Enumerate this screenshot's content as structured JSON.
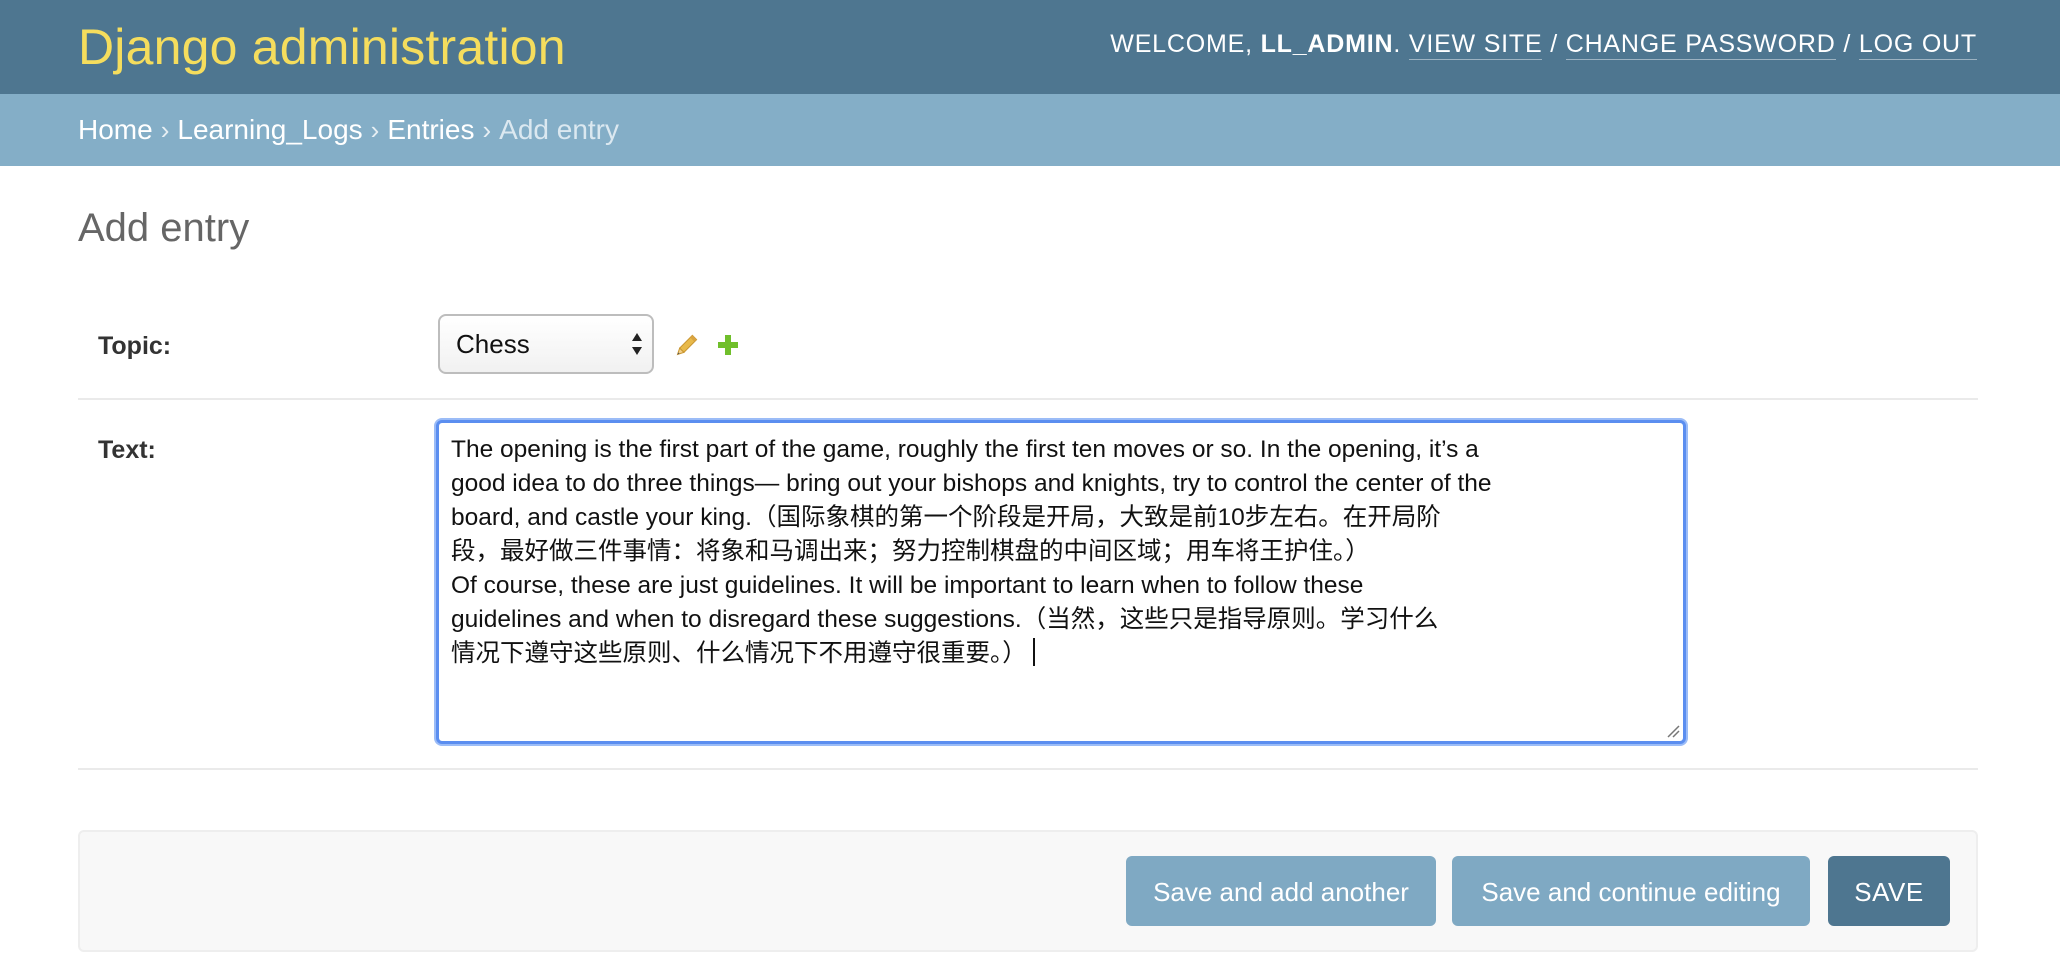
{
  "header": {
    "brand": "Django administration",
    "welcome_prefix": "WELCOME, ",
    "username": "LL_ADMIN",
    "welcome_suffix": ".",
    "view_site": "VIEW SITE",
    "separator": "/",
    "change_password": "CHANGE PASSWORD",
    "log_out": "LOG OUT"
  },
  "breadcrumbs": {
    "items": [
      "Home",
      "Learning_Logs",
      "Entries"
    ],
    "separator": "›",
    "current": "Add entry"
  },
  "page": {
    "title": "Add entry"
  },
  "form": {
    "topic": {
      "label": "Topic:",
      "selected": "Chess"
    },
    "text": {
      "label": "Text:",
      "value": "The opening is the first part of the game, roughly the first ten moves or so. In the opening, it’s a\ngood idea to do three things— bring out your bishops and knights, try to control the center of the\nboard, and castle your king.（国际象棋的第一个阶段是开局，大致是前10步左右。在开局阶\n段，最好做三件事情：将象和马调出来；努力控制棋盘的中间区域；用车将王护住。）\nOf course, these are just guidelines. It will be important to learn when to follow these\nguidelines and when to disregard these suggestions.（当然，这些只是指导原则。学习什么\n情况下遵守这些原则、什么情况下不用遵守很重要。）"
    }
  },
  "buttons": {
    "save_add_another": "Save and add another",
    "save_continue": "Save and continue editing",
    "save": "SAVE"
  },
  "colors": {
    "header_bg": "#4e7690",
    "brand": "#f5dd5d",
    "breadcrumb_bg": "#84aec7",
    "button_light": "#7fa9c3",
    "button_primary": "#4e7690",
    "focus_border": "#5b8ef0",
    "edit_icon": "#e8b94a",
    "add_icon": "#70bf2b"
  }
}
